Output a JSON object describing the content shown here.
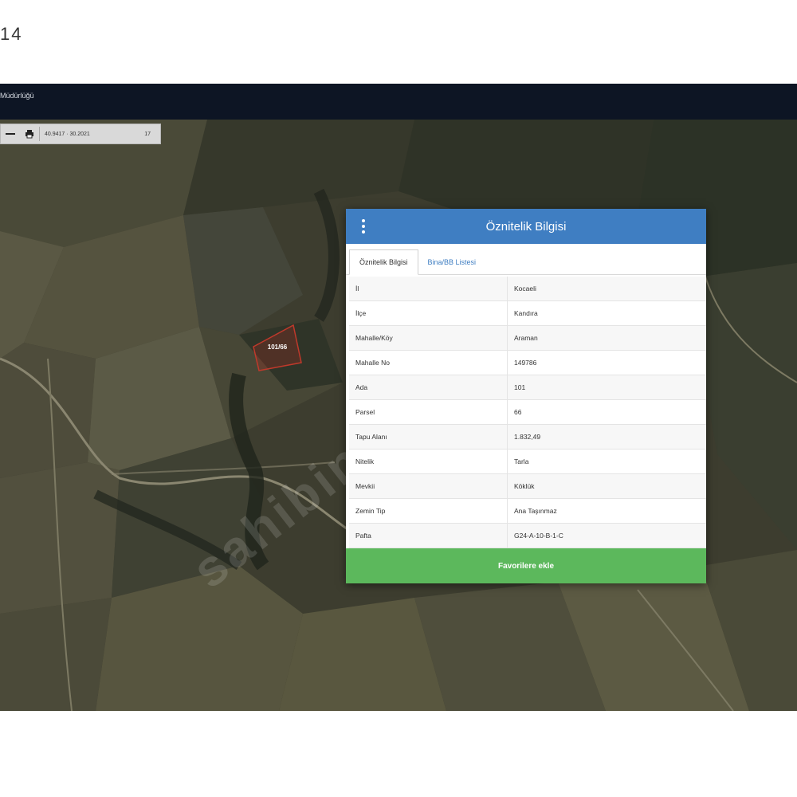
{
  "page_number": "14",
  "app": {
    "title": "Müdürlüğü"
  },
  "toolbar": {
    "coords": "40.9417 · 30.2021",
    "zoom": "17"
  },
  "map": {
    "parcel_label": "101/66",
    "watermark": "sahibinden"
  },
  "dialog": {
    "title": "Öznitelik Bilgisi",
    "tabs": [
      {
        "label": "Öznitelik Bilgisi",
        "active": true
      },
      {
        "label": "Bina/BB Listesi",
        "active": false
      }
    ],
    "rows": [
      {
        "key": "İl",
        "value": "Kocaeli"
      },
      {
        "key": "İlçe",
        "value": "Kandıra"
      },
      {
        "key": "Mahalle/Köy",
        "value": "Araman"
      },
      {
        "key": "Mahalle No",
        "value": "149786"
      },
      {
        "key": "Ada",
        "value": "101"
      },
      {
        "key": "Parsel",
        "value": "66"
      },
      {
        "key": "Tapu Alanı",
        "value": "1.832,49"
      },
      {
        "key": "Nitelik",
        "value": "Tarla"
      },
      {
        "key": "Mevkii",
        "value": "Köklük"
      },
      {
        "key": "Zemin Tip",
        "value": "Ana Taşınmaz"
      },
      {
        "key": "Pafta",
        "value": "G24-A-10-B-1-C"
      }
    ],
    "favorite_button": "Favorilere ekle"
  },
  "colors": {
    "header_bg": "#0d1524",
    "dialog_header": "#3f7ec2",
    "favorite_button": "#5cb85c",
    "parcel_outline": "#c0392b"
  }
}
